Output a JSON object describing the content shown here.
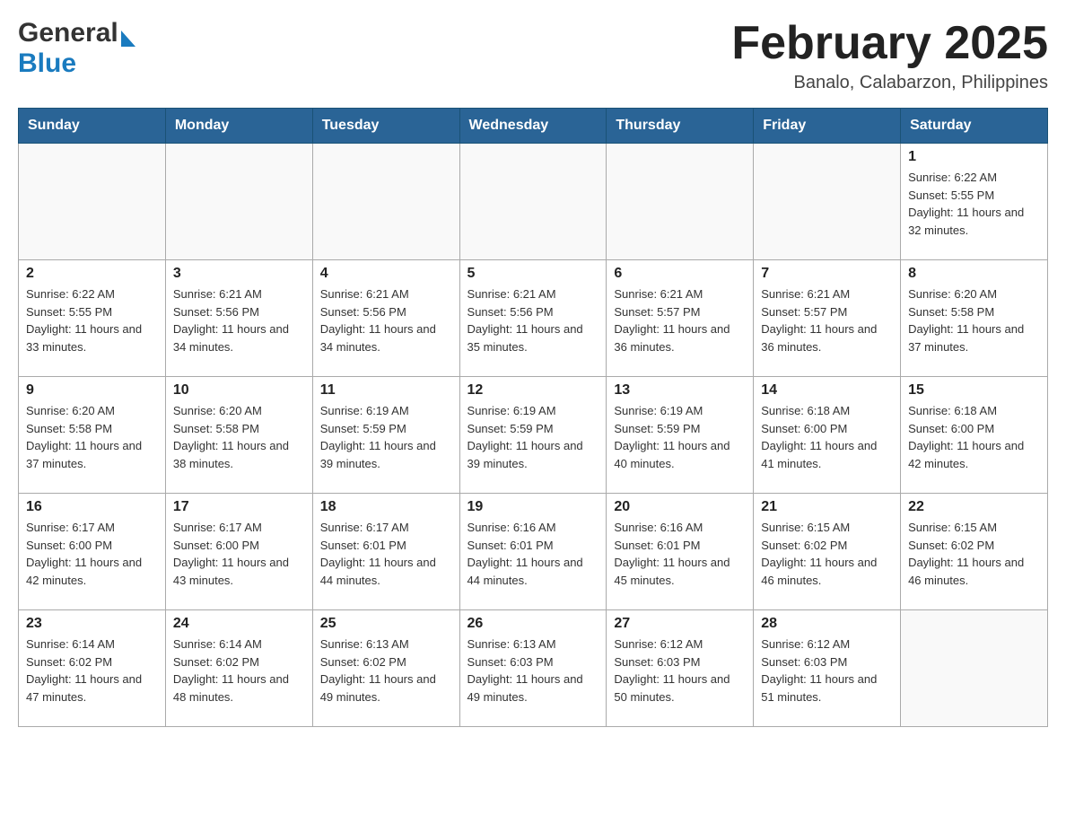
{
  "header": {
    "logo_general": "General",
    "logo_blue": "Blue",
    "month_title": "February 2025",
    "location": "Banalo, Calabarzon, Philippines"
  },
  "weekdays": [
    "Sunday",
    "Monday",
    "Tuesday",
    "Wednesday",
    "Thursday",
    "Friday",
    "Saturday"
  ],
  "weeks": [
    [
      {
        "day": "",
        "sunrise": "",
        "sunset": "",
        "daylight": ""
      },
      {
        "day": "",
        "sunrise": "",
        "sunset": "",
        "daylight": ""
      },
      {
        "day": "",
        "sunrise": "",
        "sunset": "",
        "daylight": ""
      },
      {
        "day": "",
        "sunrise": "",
        "sunset": "",
        "daylight": ""
      },
      {
        "day": "",
        "sunrise": "",
        "sunset": "",
        "daylight": ""
      },
      {
        "day": "",
        "sunrise": "",
        "sunset": "",
        "daylight": ""
      },
      {
        "day": "1",
        "sunrise": "Sunrise: 6:22 AM",
        "sunset": "Sunset: 5:55 PM",
        "daylight": "Daylight: 11 hours and 32 minutes."
      }
    ],
    [
      {
        "day": "2",
        "sunrise": "Sunrise: 6:22 AM",
        "sunset": "Sunset: 5:55 PM",
        "daylight": "Daylight: 11 hours and 33 minutes."
      },
      {
        "day": "3",
        "sunrise": "Sunrise: 6:21 AM",
        "sunset": "Sunset: 5:56 PM",
        "daylight": "Daylight: 11 hours and 34 minutes."
      },
      {
        "day": "4",
        "sunrise": "Sunrise: 6:21 AM",
        "sunset": "Sunset: 5:56 PM",
        "daylight": "Daylight: 11 hours and 34 minutes."
      },
      {
        "day": "5",
        "sunrise": "Sunrise: 6:21 AM",
        "sunset": "Sunset: 5:56 PM",
        "daylight": "Daylight: 11 hours and 35 minutes."
      },
      {
        "day": "6",
        "sunrise": "Sunrise: 6:21 AM",
        "sunset": "Sunset: 5:57 PM",
        "daylight": "Daylight: 11 hours and 36 minutes."
      },
      {
        "day": "7",
        "sunrise": "Sunrise: 6:21 AM",
        "sunset": "Sunset: 5:57 PM",
        "daylight": "Daylight: 11 hours and 36 minutes."
      },
      {
        "day": "8",
        "sunrise": "Sunrise: 6:20 AM",
        "sunset": "Sunset: 5:58 PM",
        "daylight": "Daylight: 11 hours and 37 minutes."
      }
    ],
    [
      {
        "day": "9",
        "sunrise": "Sunrise: 6:20 AM",
        "sunset": "Sunset: 5:58 PM",
        "daylight": "Daylight: 11 hours and 37 minutes."
      },
      {
        "day": "10",
        "sunrise": "Sunrise: 6:20 AM",
        "sunset": "Sunset: 5:58 PM",
        "daylight": "Daylight: 11 hours and 38 minutes."
      },
      {
        "day": "11",
        "sunrise": "Sunrise: 6:19 AM",
        "sunset": "Sunset: 5:59 PM",
        "daylight": "Daylight: 11 hours and 39 minutes."
      },
      {
        "day": "12",
        "sunrise": "Sunrise: 6:19 AM",
        "sunset": "Sunset: 5:59 PM",
        "daylight": "Daylight: 11 hours and 39 minutes."
      },
      {
        "day": "13",
        "sunrise": "Sunrise: 6:19 AM",
        "sunset": "Sunset: 5:59 PM",
        "daylight": "Daylight: 11 hours and 40 minutes."
      },
      {
        "day": "14",
        "sunrise": "Sunrise: 6:18 AM",
        "sunset": "Sunset: 6:00 PM",
        "daylight": "Daylight: 11 hours and 41 minutes."
      },
      {
        "day": "15",
        "sunrise": "Sunrise: 6:18 AM",
        "sunset": "Sunset: 6:00 PM",
        "daylight": "Daylight: 11 hours and 42 minutes."
      }
    ],
    [
      {
        "day": "16",
        "sunrise": "Sunrise: 6:17 AM",
        "sunset": "Sunset: 6:00 PM",
        "daylight": "Daylight: 11 hours and 42 minutes."
      },
      {
        "day": "17",
        "sunrise": "Sunrise: 6:17 AM",
        "sunset": "Sunset: 6:00 PM",
        "daylight": "Daylight: 11 hours and 43 minutes."
      },
      {
        "day": "18",
        "sunrise": "Sunrise: 6:17 AM",
        "sunset": "Sunset: 6:01 PM",
        "daylight": "Daylight: 11 hours and 44 minutes."
      },
      {
        "day": "19",
        "sunrise": "Sunrise: 6:16 AM",
        "sunset": "Sunset: 6:01 PM",
        "daylight": "Daylight: 11 hours and 44 minutes."
      },
      {
        "day": "20",
        "sunrise": "Sunrise: 6:16 AM",
        "sunset": "Sunset: 6:01 PM",
        "daylight": "Daylight: 11 hours and 45 minutes."
      },
      {
        "day": "21",
        "sunrise": "Sunrise: 6:15 AM",
        "sunset": "Sunset: 6:02 PM",
        "daylight": "Daylight: 11 hours and 46 minutes."
      },
      {
        "day": "22",
        "sunrise": "Sunrise: 6:15 AM",
        "sunset": "Sunset: 6:02 PM",
        "daylight": "Daylight: 11 hours and 46 minutes."
      }
    ],
    [
      {
        "day": "23",
        "sunrise": "Sunrise: 6:14 AM",
        "sunset": "Sunset: 6:02 PM",
        "daylight": "Daylight: 11 hours and 47 minutes."
      },
      {
        "day": "24",
        "sunrise": "Sunrise: 6:14 AM",
        "sunset": "Sunset: 6:02 PM",
        "daylight": "Daylight: 11 hours and 48 minutes."
      },
      {
        "day": "25",
        "sunrise": "Sunrise: 6:13 AM",
        "sunset": "Sunset: 6:02 PM",
        "daylight": "Daylight: 11 hours and 49 minutes."
      },
      {
        "day": "26",
        "sunrise": "Sunrise: 6:13 AM",
        "sunset": "Sunset: 6:03 PM",
        "daylight": "Daylight: 11 hours and 49 minutes."
      },
      {
        "day": "27",
        "sunrise": "Sunrise: 6:12 AM",
        "sunset": "Sunset: 6:03 PM",
        "daylight": "Daylight: 11 hours and 50 minutes."
      },
      {
        "day": "28",
        "sunrise": "Sunrise: 6:12 AM",
        "sunset": "Sunset: 6:03 PM",
        "daylight": "Daylight: 11 hours and 51 minutes."
      },
      {
        "day": "",
        "sunrise": "",
        "sunset": "",
        "daylight": ""
      }
    ]
  ]
}
